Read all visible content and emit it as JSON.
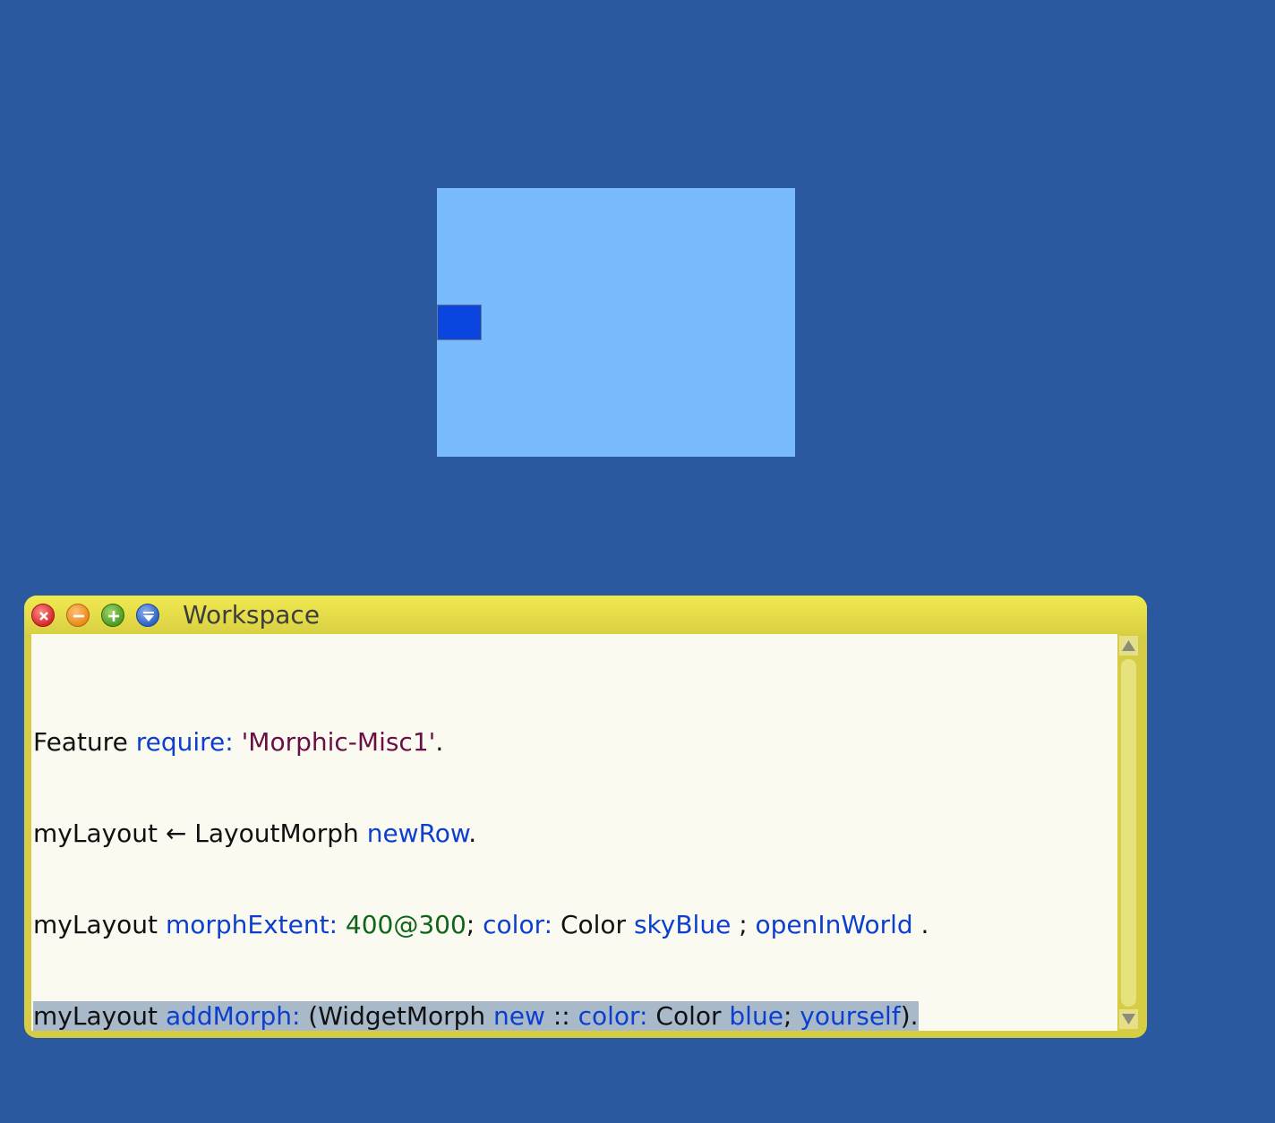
{
  "world": {
    "background_color": "#2a59a0"
  },
  "layout_morph": {
    "color": "#78bbfd",
    "widget_color": "#0a45e0"
  },
  "window": {
    "title": "Workspace",
    "buttons": {
      "close": "close-icon",
      "collapse": "minimize-icon",
      "expand": "expand-icon",
      "menu": "menu-icon"
    },
    "frame_color": "#d6cd45"
  },
  "code": {
    "line1": {
      "a": "Feature ",
      "b": "require: ",
      "c": "'Morphic-Misc1'",
      "d": "."
    },
    "line2": {
      "a": "myLayout ← LayoutMorph ",
      "b": "newRow",
      "c": "."
    },
    "line3": {
      "a": "myLayout ",
      "b": "morphExtent: ",
      "c": "400@300",
      "d": "; ",
      "e": "color: ",
      "f": "Color ",
      "g": "skyBlue",
      "h": " ; ",
      "i": "openInWorld",
      "j": " ."
    },
    "line4": {
      "a": "myLayout ",
      "b": "addMorph: ",
      "c": "(WidgetMorph ",
      "d": "new",
      "e": " :: ",
      "f": "color: ",
      "g": "Color ",
      "h": "blue",
      "i": "; ",
      "j": "yourself",
      "k": ")."
    }
  },
  "scrollbar": {
    "up": "up-arrow-icon",
    "down": "down-arrow-icon"
  }
}
